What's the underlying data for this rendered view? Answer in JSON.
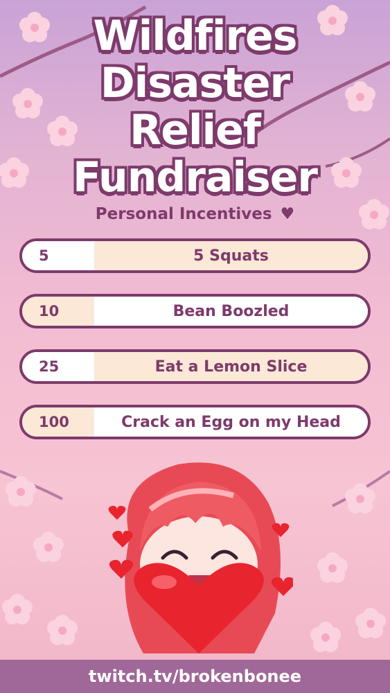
{
  "title_lines": [
    "Wildfires",
    "Disaster",
    "Relief",
    "Fundraiser"
  ],
  "subtitle": "Personal Incentives",
  "subtitle_icon": "heart-icon",
  "incentives": [
    {
      "amount": "5",
      "label": "5 Squats"
    },
    {
      "amount": "10",
      "label": "Bean Boozled"
    },
    {
      "amount": "25",
      "label": "Eat a Lemon Slice"
    },
    {
      "amount": "100",
      "label": "Crack an Egg on my Head"
    }
  ],
  "footer_text": "twitch.tv/brokenbonee",
  "colors": {
    "accent": "#7d3a6b",
    "row_fill": "#fbe8d6",
    "footer_bg": "#a06898",
    "heart_red": "#e8242e"
  }
}
